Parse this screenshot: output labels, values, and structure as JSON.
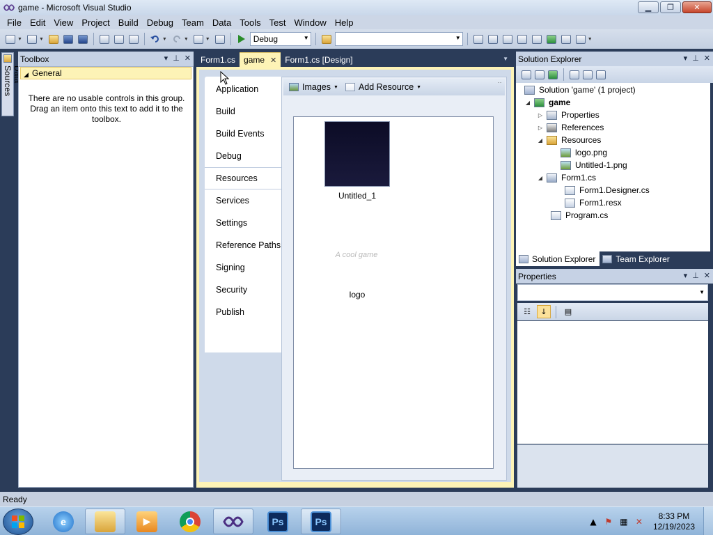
{
  "window": {
    "title": "game - Microsoft Visual Studio",
    "controls": {
      "minimize": "▁",
      "maximize": "❐",
      "close": "✕"
    }
  },
  "menu": [
    "File",
    "Edit",
    "View",
    "Project",
    "Build",
    "Debug",
    "Team",
    "Data",
    "Tools",
    "Test",
    "Window",
    "Help"
  ],
  "toolbar": {
    "config_value": "Debug",
    "platform_value": ""
  },
  "side_tab": {
    "label": "Data Sources"
  },
  "toolbox": {
    "title": "Toolbox",
    "group_label": "General",
    "empty_message": "There are no usable controls in this group. Drag an item onto this text to add it to the toolbox."
  },
  "doc_tabs": [
    {
      "label": "Form1.cs",
      "active": false
    },
    {
      "label": "game",
      "active": true
    },
    {
      "label": "Form1.cs [Design]",
      "active": false
    }
  ],
  "project_designer": {
    "nav_items": [
      "Application",
      "Build",
      "Build Events",
      "Debug",
      "Resources",
      "Services",
      "Settings",
      "Reference Paths",
      "Signing",
      "Security",
      "Publish"
    ],
    "selected_nav": "Resources",
    "resources_toolbar": {
      "category": "Images",
      "add_resource": "Add Resource"
    },
    "resources": [
      {
        "name": "Untitled_1",
        "thumbnail": "dark-navy-image"
      },
      {
        "name": "logo",
        "thumbnail_text": "A cool game"
      }
    ]
  },
  "solution_explorer": {
    "title": "Solution Explorer",
    "tree": [
      {
        "label": "Solution 'game' (1 project)",
        "icon": "solution-icon",
        "level": 0,
        "expander": ""
      },
      {
        "label": "game",
        "icon": "csharp-project-icon",
        "level": 1,
        "expander": "◢",
        "bold": true
      },
      {
        "label": "Properties",
        "icon": "properties-icon",
        "level": 2,
        "expander": "▷"
      },
      {
        "label": "References",
        "icon": "references-icon",
        "level": 2,
        "expander": "▷"
      },
      {
        "label": "Resources",
        "icon": "folder-icon",
        "level": 2,
        "expander": "◢"
      },
      {
        "label": "logo.png",
        "icon": "image-file-icon",
        "level": 3,
        "expander": ""
      },
      {
        "label": "Untitled-1.png",
        "icon": "image-file-icon",
        "level": 3,
        "expander": ""
      },
      {
        "label": "Form1.cs",
        "icon": "form-icon",
        "level": 2,
        "expander": "◢"
      },
      {
        "label": "Form1.Designer.cs",
        "icon": "csharp-file-icon",
        "level": 3,
        "expander": ""
      },
      {
        "label": "Form1.resx",
        "icon": "resx-file-icon",
        "level": 3,
        "expander": ""
      },
      {
        "label": "Program.cs",
        "icon": "csharp-file-icon",
        "level": 2,
        "expander": ""
      }
    ],
    "tabs": [
      {
        "label": "Solution Explorer",
        "active": true
      },
      {
        "label": "Team Explorer",
        "active": false
      }
    ]
  },
  "properties": {
    "title": "Properties"
  },
  "status": {
    "text": "Ready"
  },
  "taskbar": {
    "apps": [
      "internet-explorer",
      "file-explorer",
      "media-player",
      "chrome",
      "visual-studio",
      "photoshop",
      "photoshop"
    ],
    "clock_time": "8:33 PM",
    "clock_date": "12/19/2023",
    "ps_label": "Ps"
  },
  "colors": {
    "ide_background": "#2b3c59",
    "active_tab": "#fdf3b6",
    "tool_title": "#c6d2e5"
  }
}
